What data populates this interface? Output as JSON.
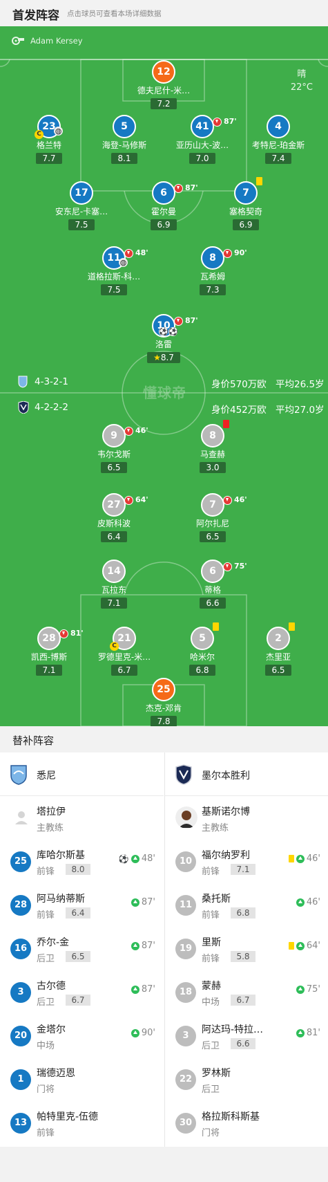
{
  "header": {
    "title": "首发阵容",
    "subtitle": "点击球员可查看本场详细数据"
  },
  "referee": {
    "name": "Adam Kersey"
  },
  "weather": {
    "condition": "晴",
    "temp": "22°C"
  },
  "watermark": "懂球帝",
  "home": {
    "formation": "4-3-2-1",
    "value": "身价570万欧",
    "avg_age": "平均26.5岁",
    "players": [
      {
        "num": "12",
        "name": "德夫尼什-米…",
        "rating": "7.2",
        "gk": true
      },
      {
        "num": "23",
        "name": "格兰特",
        "rating": "7.7",
        "captain": true,
        "ball": true
      },
      {
        "num": "5",
        "name": "海登-马修斯",
        "rating": "8.1"
      },
      {
        "num": "41",
        "name": "亚历山大-波…",
        "rating": "7.0",
        "sub_min": "87'"
      },
      {
        "num": "4",
        "name": "考特尼-珀金斯",
        "rating": "7.4"
      },
      {
        "num": "17",
        "name": "安东尼-卡塞…",
        "rating": "7.5"
      },
      {
        "num": "6",
        "name": "霍尔曼",
        "rating": "6.9",
        "sub_min": "87'"
      },
      {
        "num": "7",
        "name": "塞格契奇",
        "rating": "6.9",
        "yellow": true
      },
      {
        "num": "11",
        "name": "道格拉斯-科…",
        "rating": "7.5",
        "sub_min": "48'",
        "ball": true
      },
      {
        "num": "8",
        "name": "瓦希姆",
        "rating": "7.3",
        "sub_min": "90'"
      },
      {
        "num": "10",
        "name": "洛雷",
        "rating": "8.7",
        "sub_min": "87'",
        "goals": 2,
        "star": true
      }
    ]
  },
  "away": {
    "formation": "4-2-2-2",
    "value": "身价452万欧",
    "avg_age": "平均27.0岁",
    "players": [
      {
        "num": "9",
        "name": "韦尔戈斯",
        "rating": "6.5",
        "sub_min": "46'"
      },
      {
        "num": "8",
        "name": "马查赫",
        "rating": "3.0",
        "red": true
      },
      {
        "num": "27",
        "name": "皮斯科波",
        "rating": "6.4",
        "sub_min": "64'"
      },
      {
        "num": "7",
        "name": "阿尔扎尼",
        "rating": "6.5",
        "sub_min": "46'"
      },
      {
        "num": "14",
        "name": "瓦拉东",
        "rating": "7.1"
      },
      {
        "num": "6",
        "name": "蒂格",
        "rating": "6.6",
        "sub_min": "75'"
      },
      {
        "num": "28",
        "name": "凯西-博斯",
        "rating": "7.1",
        "sub_min": "81'"
      },
      {
        "num": "21",
        "name": "罗德里克-米…",
        "rating": "6.7",
        "captain": true
      },
      {
        "num": "5",
        "name": "哈米尔",
        "rating": "6.8",
        "yellow": true
      },
      {
        "num": "2",
        "name": "杰里亚",
        "rating": "6.5",
        "yellow": true
      },
      {
        "num": "25",
        "name": "杰克-邓肯",
        "rating": "7.8",
        "gk": true
      }
    ]
  },
  "subs": {
    "title": "替补阵容",
    "home_team": "悉尼",
    "away_team": "墨尔本胜利",
    "home": [
      {
        "coach": true,
        "name": "塔拉伊",
        "pos": "主教练"
      },
      {
        "num": "25",
        "name": "库哈尔斯基",
        "pos": "前锋",
        "rating": "8.0",
        "goal": true,
        "min": "48'"
      },
      {
        "num": "28",
        "name": "阿马纳蒂斯",
        "pos": "前锋",
        "rating": "6.4",
        "min": "87'"
      },
      {
        "num": "16",
        "name": "乔尔-金",
        "pos": "后卫",
        "rating": "6.5",
        "min": "87'"
      },
      {
        "num": "3",
        "name": "古尔德",
        "pos": "后卫",
        "rating": "6.7",
        "min": "87'"
      },
      {
        "num": "20",
        "name": "金塔尔",
        "pos": "中场",
        "min": "90'"
      },
      {
        "num": "1",
        "name": "瑞德迈恩",
        "pos": "门将"
      },
      {
        "num": "13",
        "name": "帕特里克-伍德",
        "pos": "前锋"
      }
    ],
    "away": [
      {
        "coach": true,
        "name": "基斯诺尔博",
        "pos": "主教练"
      },
      {
        "num": "10",
        "name": "福尔纳罗利",
        "pos": "前锋",
        "rating": "7.1",
        "yellow": true,
        "min": "46'"
      },
      {
        "num": "11",
        "name": "桑托斯",
        "pos": "前锋",
        "rating": "6.8",
        "min": "46'"
      },
      {
        "num": "19",
        "name": "里斯",
        "pos": "前锋",
        "rating": "5.8",
        "yellow": true,
        "min": "64'"
      },
      {
        "num": "18",
        "name": "蒙赫",
        "pos": "中场",
        "rating": "6.7",
        "min": "75'"
      },
      {
        "num": "3",
        "name": "阿达玛-特拉…",
        "pos": "后卫",
        "rating": "6.6",
        "min": "81'"
      },
      {
        "num": "22",
        "name": "罗林斯",
        "pos": "后卫"
      },
      {
        "num": "30",
        "name": "格拉斯科斯基",
        "pos": "门将"
      }
    ]
  }
}
